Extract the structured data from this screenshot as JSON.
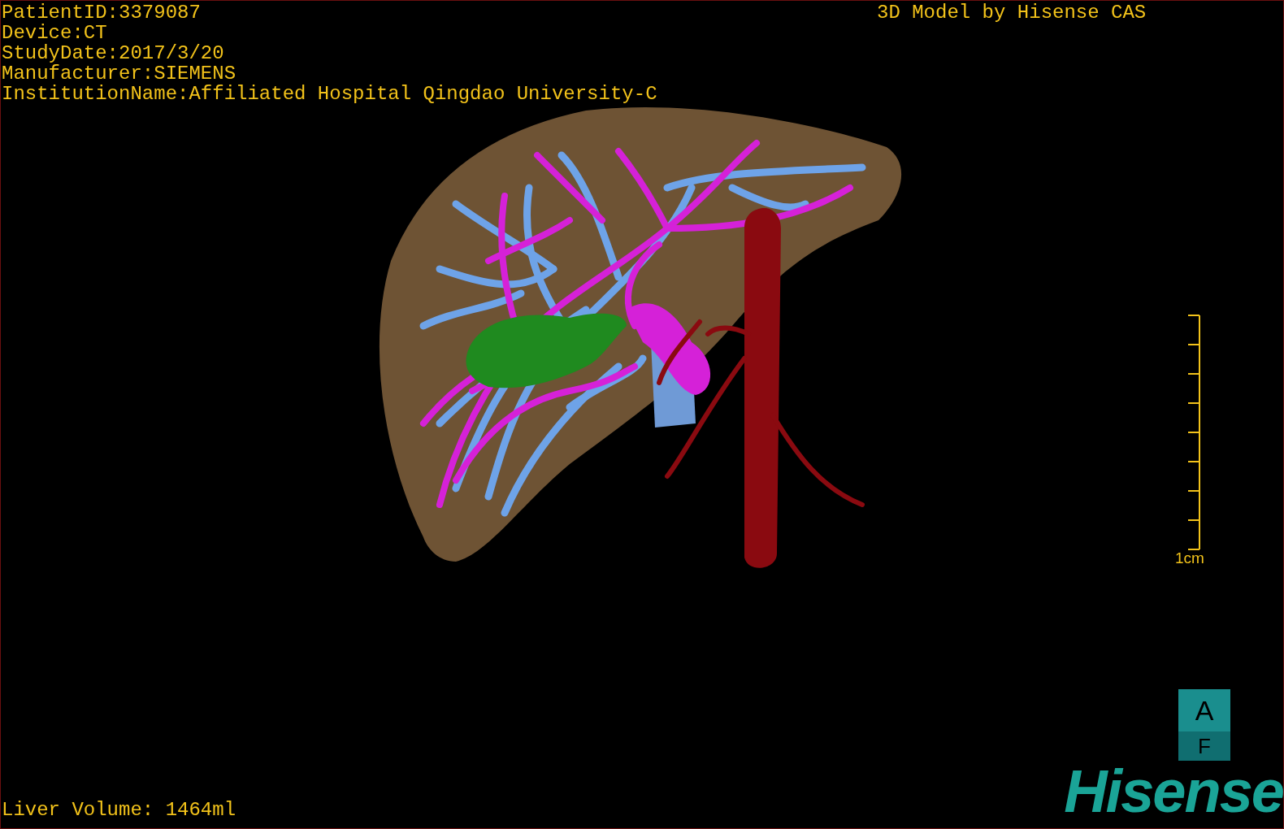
{
  "info_lines": [
    "PatientID:3379087",
    "Device:CT",
    "StudyDate:2017/3/20",
    "Manufacturer:SIEMENS",
    "InstitutionName:Affiliated Hospital Qingdao University-C"
  ],
  "title": "3D Model by Hisense CAS",
  "scale": {
    "label": "1cm"
  },
  "orientation_cube": {
    "top": "A",
    "bottom": "F"
  },
  "logo": "Hisense",
  "liver_volume": "Liver Volume: 1464ml"
}
